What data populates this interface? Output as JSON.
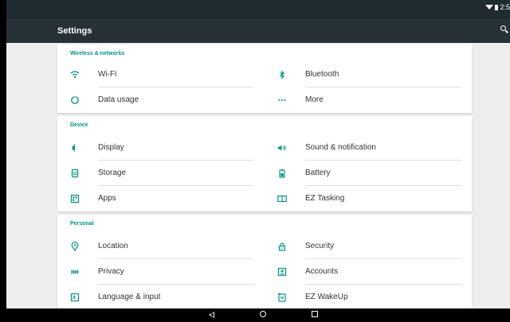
{
  "status_bar": {
    "time": "2:5"
  },
  "app_bar": {
    "title": "Settings"
  },
  "sections": [
    {
      "title": "Wireless & networks",
      "items": [
        {
          "label": "Wi-Fi",
          "icon": "wifi-icon"
        },
        {
          "label": "Bluetooth",
          "icon": "bluetooth-icon"
        },
        {
          "label": "Data usage",
          "icon": "data-usage-icon"
        },
        {
          "label": "More",
          "icon": "more-icon"
        }
      ]
    },
    {
      "title": "Device",
      "items": [
        {
          "label": "Display",
          "icon": "display-icon"
        },
        {
          "label": "Sound & notification",
          "icon": "sound-icon"
        },
        {
          "label": "Storage",
          "icon": "storage-icon"
        },
        {
          "label": "Battery",
          "icon": "battery-icon"
        },
        {
          "label": "Apps",
          "icon": "apps-icon"
        },
        {
          "label": "EZ Tasking",
          "icon": "ez-tasking-icon"
        }
      ]
    },
    {
      "title": "Personal",
      "items": [
        {
          "label": "Location",
          "icon": "location-icon"
        },
        {
          "label": "Security",
          "icon": "lock-icon"
        },
        {
          "label": "Privacy",
          "icon": "privacy-icon"
        },
        {
          "label": "Accounts",
          "icon": "accounts-icon"
        },
        {
          "label": "Language & input",
          "icon": "language-icon"
        },
        {
          "label": "EZ WakeUp",
          "icon": "ez-wakeup-icon"
        }
      ]
    }
  ],
  "colors": {
    "accent": "#009688",
    "app_bar": "#273238",
    "status_bar": "#1e2b30",
    "background": "#eeeeee"
  }
}
